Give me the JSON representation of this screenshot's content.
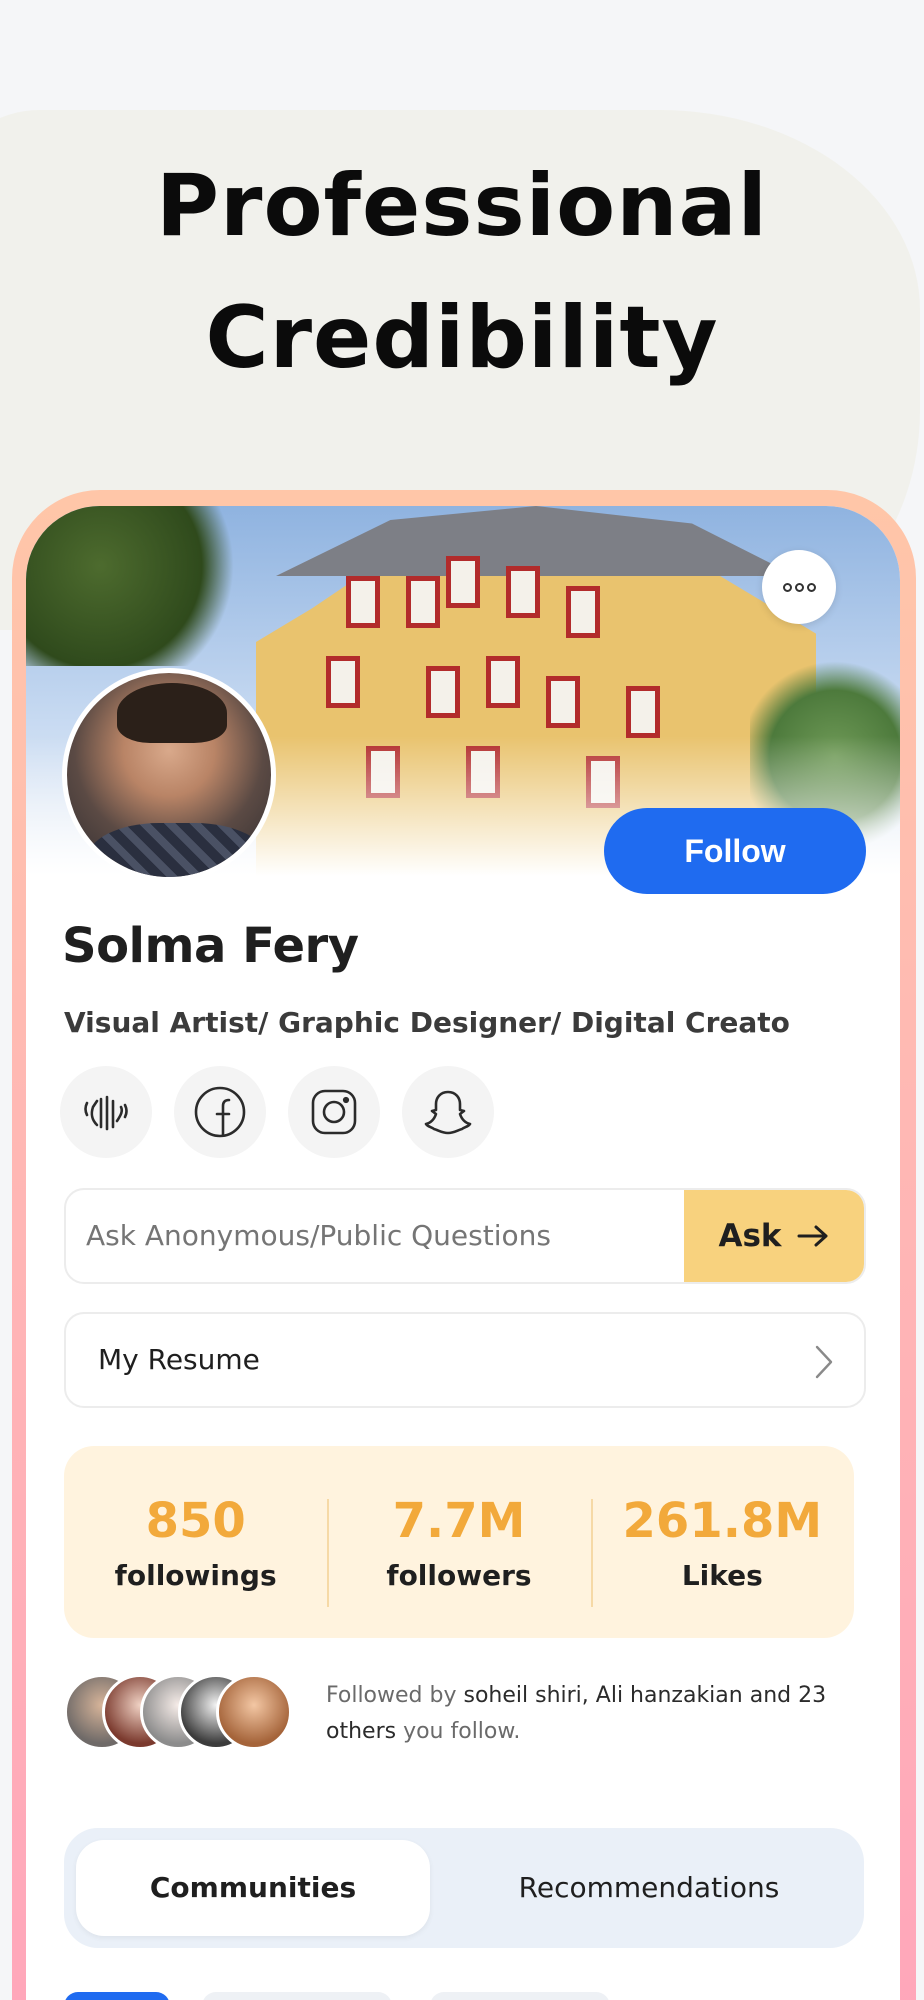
{
  "hero": {
    "line1": "Professional",
    "line2": "Credibility"
  },
  "profile": {
    "name": "Solma Fery",
    "bio": "Visual Artist/ Graphic Designer/ Digital Creato",
    "follow_label": "Follow"
  },
  "social_icons": [
    "wave-hand-icon",
    "facebook-icon",
    "instagram-icon",
    "snapchat-icon"
  ],
  "ask": {
    "placeholder": "Ask Anonymous/Public Questions",
    "button_label": "Ask"
  },
  "resume": {
    "label": "My Resume"
  },
  "stats": [
    {
      "value": "850",
      "label": "followings"
    },
    {
      "value": "7.7M",
      "label": "followers"
    },
    {
      "value": "261.8M",
      "label": "Likes"
    }
  ],
  "followed_by": {
    "prefix": "Followed by",
    "names": "soheil shiri, Ali hanzakian and 23 others",
    "suffix": "you follow."
  },
  "tabs": {
    "active": "Communities",
    "inactive": "Recommendations"
  },
  "colors": {
    "accent_blue": "#1f6bf0",
    "ask_yellow": "#f8d27e",
    "stat_orange": "#f2a93b",
    "stats_bg": "#fff3de",
    "frame_gradient": [
      "#ffc6a8",
      "#ffa6bb"
    ]
  }
}
